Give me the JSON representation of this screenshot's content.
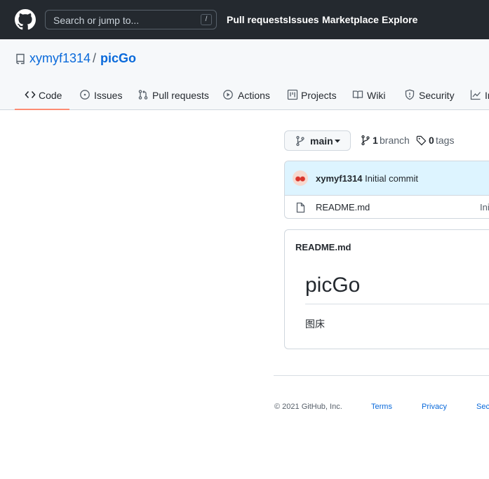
{
  "header": {
    "search_placeholder": "Search or jump to...",
    "search_shortcut": "/",
    "nav": [
      "Pull requests",
      "Issues",
      "Marketplace",
      "Explore"
    ]
  },
  "repo": {
    "owner": "xymyf1314",
    "separator": "/",
    "name": "picGo"
  },
  "tabs": [
    {
      "label": "Code",
      "icon": "code-icon",
      "active": true
    },
    {
      "label": "Issues",
      "icon": "issue-opened-icon"
    },
    {
      "label": "Pull requests",
      "icon": "git-pull-request-icon"
    },
    {
      "label": "Actions",
      "icon": "play-icon"
    },
    {
      "label": "Projects",
      "icon": "project-icon"
    },
    {
      "label": "Wiki",
      "icon": "book-icon"
    },
    {
      "label": "Security",
      "icon": "shield-icon"
    },
    {
      "label": "In",
      "icon": "graph-icon"
    }
  ],
  "branch": {
    "current": "main",
    "branch_count": "1",
    "branch_label": "branch",
    "tag_count": "0",
    "tag_label": "tags"
  },
  "commit": {
    "author": "xymyf1314",
    "message": "Initial commit"
  },
  "files": [
    {
      "name": "README.md",
      "message": "Ini"
    }
  ],
  "readme": {
    "title": "README.md",
    "heading": "picGo",
    "body": "图床"
  },
  "footer": {
    "copyright": "© 2021 GitHub, Inc.",
    "links": [
      "Terms",
      "Privacy",
      "Sec"
    ]
  },
  "colors": {
    "header_bg": "#24292f",
    "link": "#0969da",
    "active_tab_underline": "#fd8c73",
    "commit_row_bg": "#ddf4ff"
  }
}
